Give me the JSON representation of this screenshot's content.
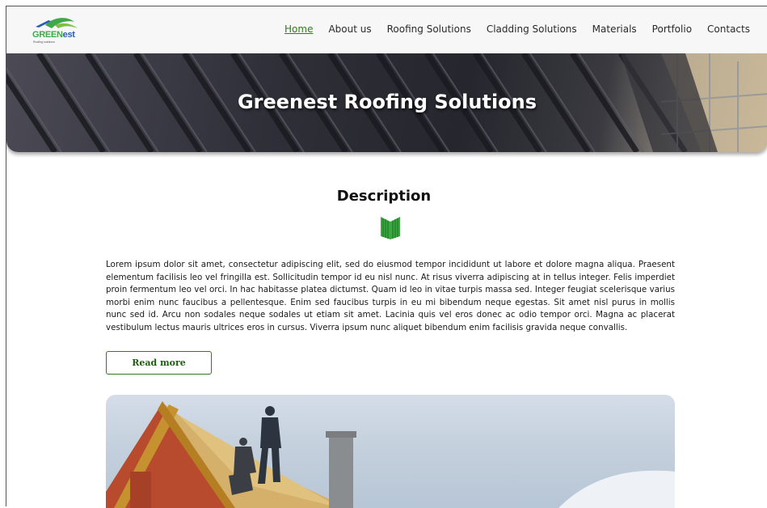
{
  "header": {
    "logo": {
      "text_green": "GREEN",
      "text_blue": "est",
      "tagline": "Roofing solutions"
    },
    "nav": [
      {
        "label": "Home",
        "active": true
      },
      {
        "label": "About us"
      },
      {
        "label": "Roofing Solutions"
      },
      {
        "label": "Cladding Solutions"
      },
      {
        "label": "Materials"
      },
      {
        "label": "Portfolio"
      },
      {
        "label": "Contacts"
      }
    ]
  },
  "hero": {
    "title": "Greenest Roofing Solutions"
  },
  "description": {
    "title": "Description",
    "icon": "green-roof-icon",
    "text": "Lorem ipsum dolor sit amet, consectetur adipiscing elit, sed do eiusmod tempor incididunt ut labore et dolore magna aliqua. Praesent elementum facilisis leo vel fringilla est. Sollicitudin tempor id eu nisl nunc. At risus viverra adipiscing at in tellus integer. Felis imperdiet proin fermentum leo vel orci. In hac habitasse platea dictumst. Quam id leo in vitae turpis massa sed. Integer feugiat scelerisque varius morbi enim nunc faucibus a pellentesque. Enim sed faucibus turpis in eu mi bibendum neque egestas. Sit amet nisl purus in mollis nunc sed id. Arcu non sodales neque sodales ut etiam sit amet. Lacinia quis vel eros donec ac odio tempor orci. Magna ac placerat vestibulum lectus mauris ultrices eros in cursus. Viverra ipsum nunc aliquet bibendum enim facilisis gravida neque convallis.",
    "button_label": "Read more"
  },
  "colors": {
    "accent_green": "#2e7d18",
    "logo_blue": "#2b5db0",
    "hero_dark": "#2f2f38"
  }
}
